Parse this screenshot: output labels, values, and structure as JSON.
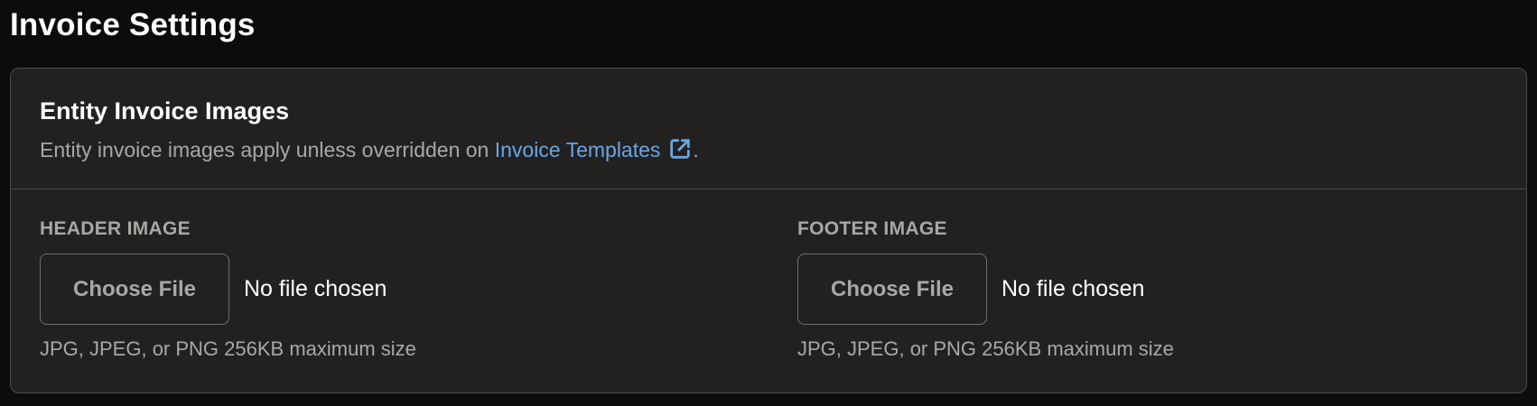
{
  "page": {
    "title": "Invoice Settings"
  },
  "card": {
    "title": "Entity Invoice Images",
    "description_prefix": "Entity invoice images apply unless overridden on ",
    "link_text": "Invoice Templates",
    "description_suffix": "."
  },
  "header_image": {
    "label": "HEADER IMAGE",
    "button_label": "Choose File",
    "status": "No file chosen",
    "hint": "JPG, JPEG, or PNG 256KB maximum size"
  },
  "footer_image": {
    "label": "FOOTER IMAGE",
    "button_label": "Choose File",
    "status": "No file chosen",
    "hint": "JPG, JPEG, or PNG 256KB maximum size"
  },
  "icons": {
    "external_link": "external-link-icon"
  },
  "colors": {
    "background": "#0c0c0c",
    "card": "#222120",
    "border": "#4c4b49",
    "link": "#6aa6e6",
    "muted_text": "#a9a8a5",
    "text": "#ffffff"
  }
}
